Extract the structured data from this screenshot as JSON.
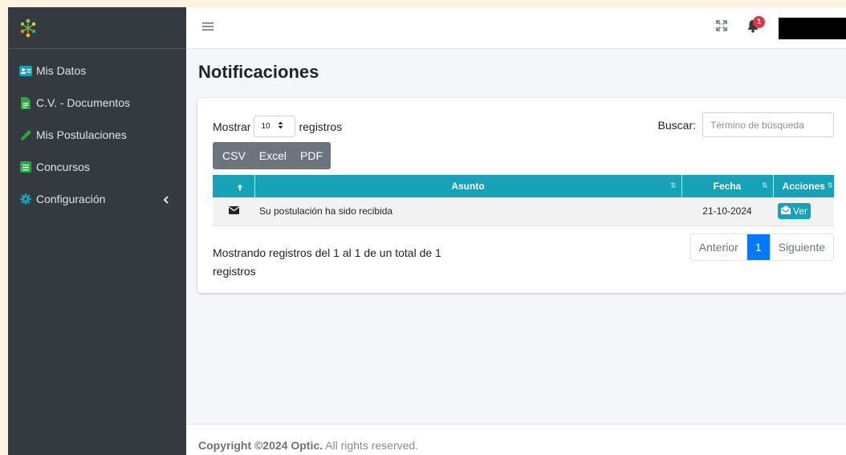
{
  "sidebar": {
    "items": [
      {
        "label": "Mis Datos",
        "icon": "id-card-icon"
      },
      {
        "label": "C.V. - Documentos",
        "icon": "file-icon"
      },
      {
        "label": "Mis Postulaciones",
        "icon": "pencil-icon"
      },
      {
        "label": "Concursos",
        "icon": "list-icon"
      },
      {
        "label": "Configuración",
        "icon": "gear-icon"
      }
    ]
  },
  "header": {
    "notifications_count": "1"
  },
  "page": {
    "title": "Notificaciones"
  },
  "table_controls": {
    "show_label": "Mostrar",
    "page_length": "10",
    "records_label": "registros",
    "search_label": "Buscar:",
    "search_placeholder": "Término de búsqueda",
    "buttons": [
      "CSV",
      "Excel",
      "PDF"
    ]
  },
  "table": {
    "columns": [
      "",
      "Asunto",
      "Fecha",
      "Acciones"
    ],
    "rows": [
      {
        "subject": "Su postulación ha sido recibida",
        "date": "21-10-2024",
        "action": "Ver"
      }
    ]
  },
  "pagination": {
    "info": "Mostrando registros del 1 al 1 de un total de 1 registros",
    "previous": "Anterior",
    "current": "1",
    "next": "Siguiente"
  },
  "footer": {
    "copyright": "Copyright ©2024 Optic.",
    "rights": " All rights reserved."
  },
  "colors": {
    "sidebar_bg": "#343a40",
    "accent_teal": "#17a2b8",
    "primary": "#007bff",
    "badge_red": "#dc3545",
    "button_gray": "#6c757d"
  }
}
